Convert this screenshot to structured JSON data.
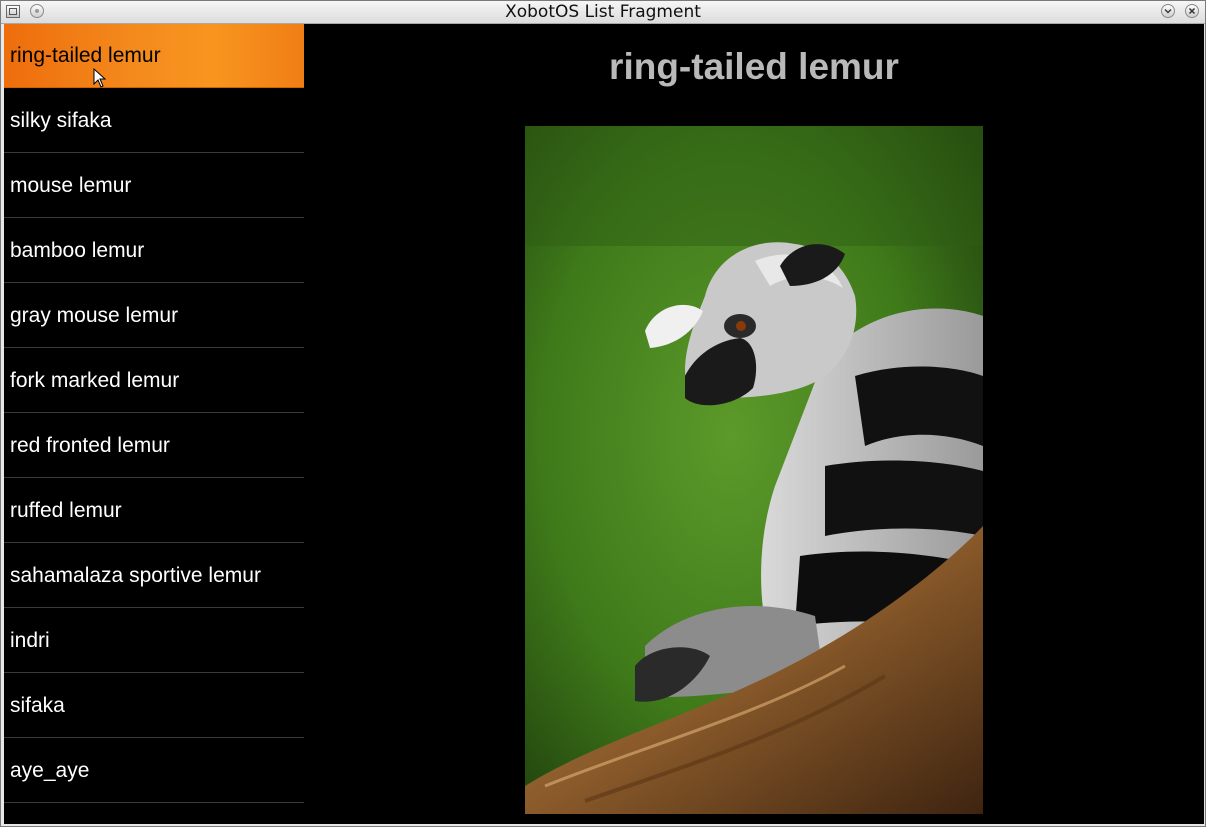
{
  "window": {
    "title": "XobotOS List Fragment"
  },
  "list": {
    "selected_index": 0,
    "items": [
      "ring-tailed lemur",
      "silky sifaka",
      "mouse lemur",
      "bamboo lemur",
      "gray mouse lemur",
      "fork marked lemur",
      "red fronted lemur",
      "ruffed lemur",
      "sahamalaza sportive lemur",
      "indri",
      "sifaka",
      "aye_aye"
    ]
  },
  "detail": {
    "title": "ring-tailed lemur"
  },
  "colors": {
    "selection": "#f48b1d",
    "background": "#000000",
    "detail_title": "#b9b9b9"
  }
}
